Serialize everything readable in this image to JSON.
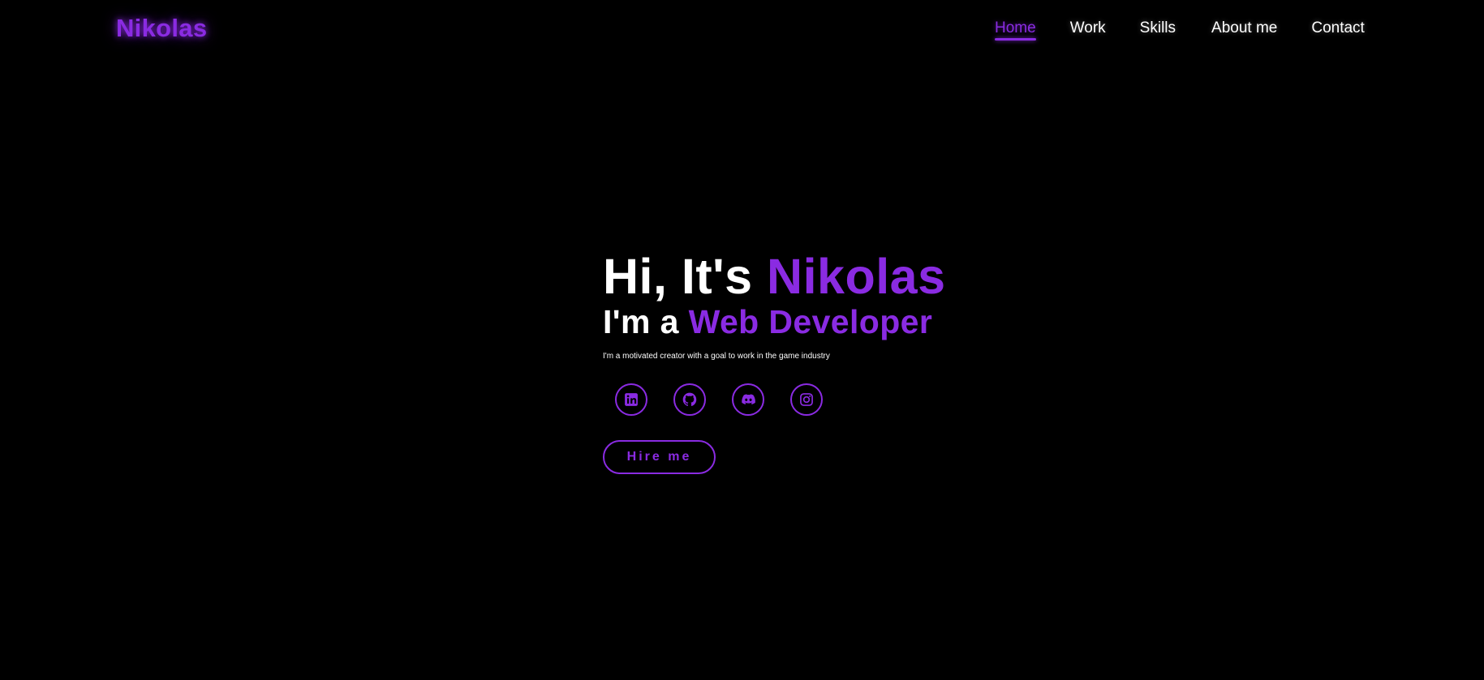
{
  "header": {
    "logo": "Nikolas",
    "nav": [
      {
        "label": "Home",
        "active": true
      },
      {
        "label": "Work",
        "active": false
      },
      {
        "label": "Skills",
        "active": false
      },
      {
        "label": "About me",
        "active": false
      },
      {
        "label": "Contact",
        "active": false
      }
    ]
  },
  "hero": {
    "greeting_prefix": "Hi, It's ",
    "name": "Nikolas",
    "role_prefix": "I'm a ",
    "role": "Web Developer",
    "tagline": "I'm a motivated creator with a goal to work in the game industry",
    "socials": [
      {
        "icon": "linkedin-icon"
      },
      {
        "icon": "github-icon"
      },
      {
        "icon": "discord-icon"
      },
      {
        "icon": "instagram-icon"
      }
    ],
    "cta_label": "Hire me"
  },
  "colors": {
    "background": "#000000",
    "accent": "#8a2be2",
    "text": "#ffffff"
  }
}
